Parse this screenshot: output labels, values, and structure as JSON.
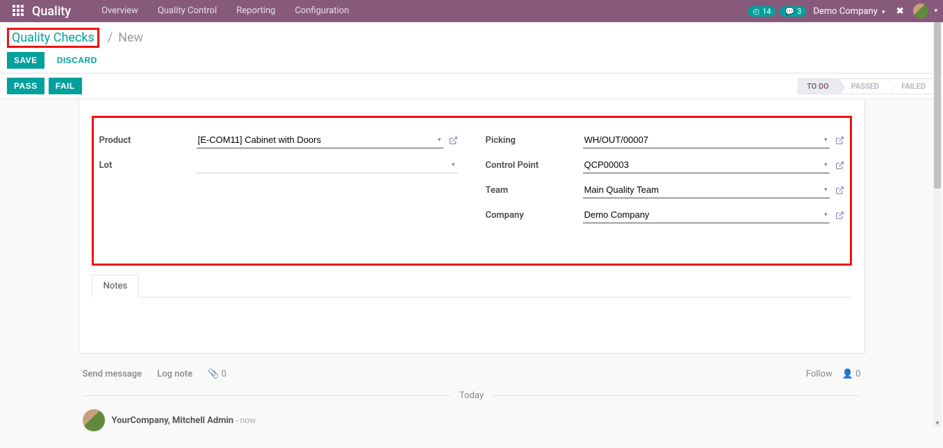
{
  "navbar": {
    "brand": "Quality",
    "menu": [
      "Overview",
      "Quality Control",
      "Reporting",
      "Configuration"
    ],
    "activities": "14",
    "messages": "3",
    "company": "Demo Company"
  },
  "breadcrumb": {
    "link": "Quality Checks",
    "current": "New"
  },
  "buttons": {
    "save": "SAVE",
    "discard": "DISCARD",
    "pass": "PASS",
    "fail": "FAIL"
  },
  "statusbar": {
    "steps": [
      "TO DO",
      "PASSED",
      "FAILED"
    ],
    "active": 0
  },
  "form": {
    "labels": {
      "product": "Product",
      "lot": "Lot",
      "picking": "Picking",
      "control_point": "Control Point",
      "team": "Team",
      "company": "Company"
    },
    "values": {
      "product": "[E-COM11] Cabinet with Doors",
      "lot": "",
      "picking": "WH/OUT/00007",
      "control_point": "QCP00003",
      "team": "Main Quality Team",
      "company": "Demo Company"
    }
  },
  "tabs": {
    "notes": "Notes"
  },
  "chatter": {
    "send": "Send message",
    "log": "Log note",
    "attach_count": "0",
    "follow": "Follow",
    "follower_count": "0",
    "divider": "Today",
    "author": "YourCompany, Mitchell Admin",
    "time": "- now"
  }
}
